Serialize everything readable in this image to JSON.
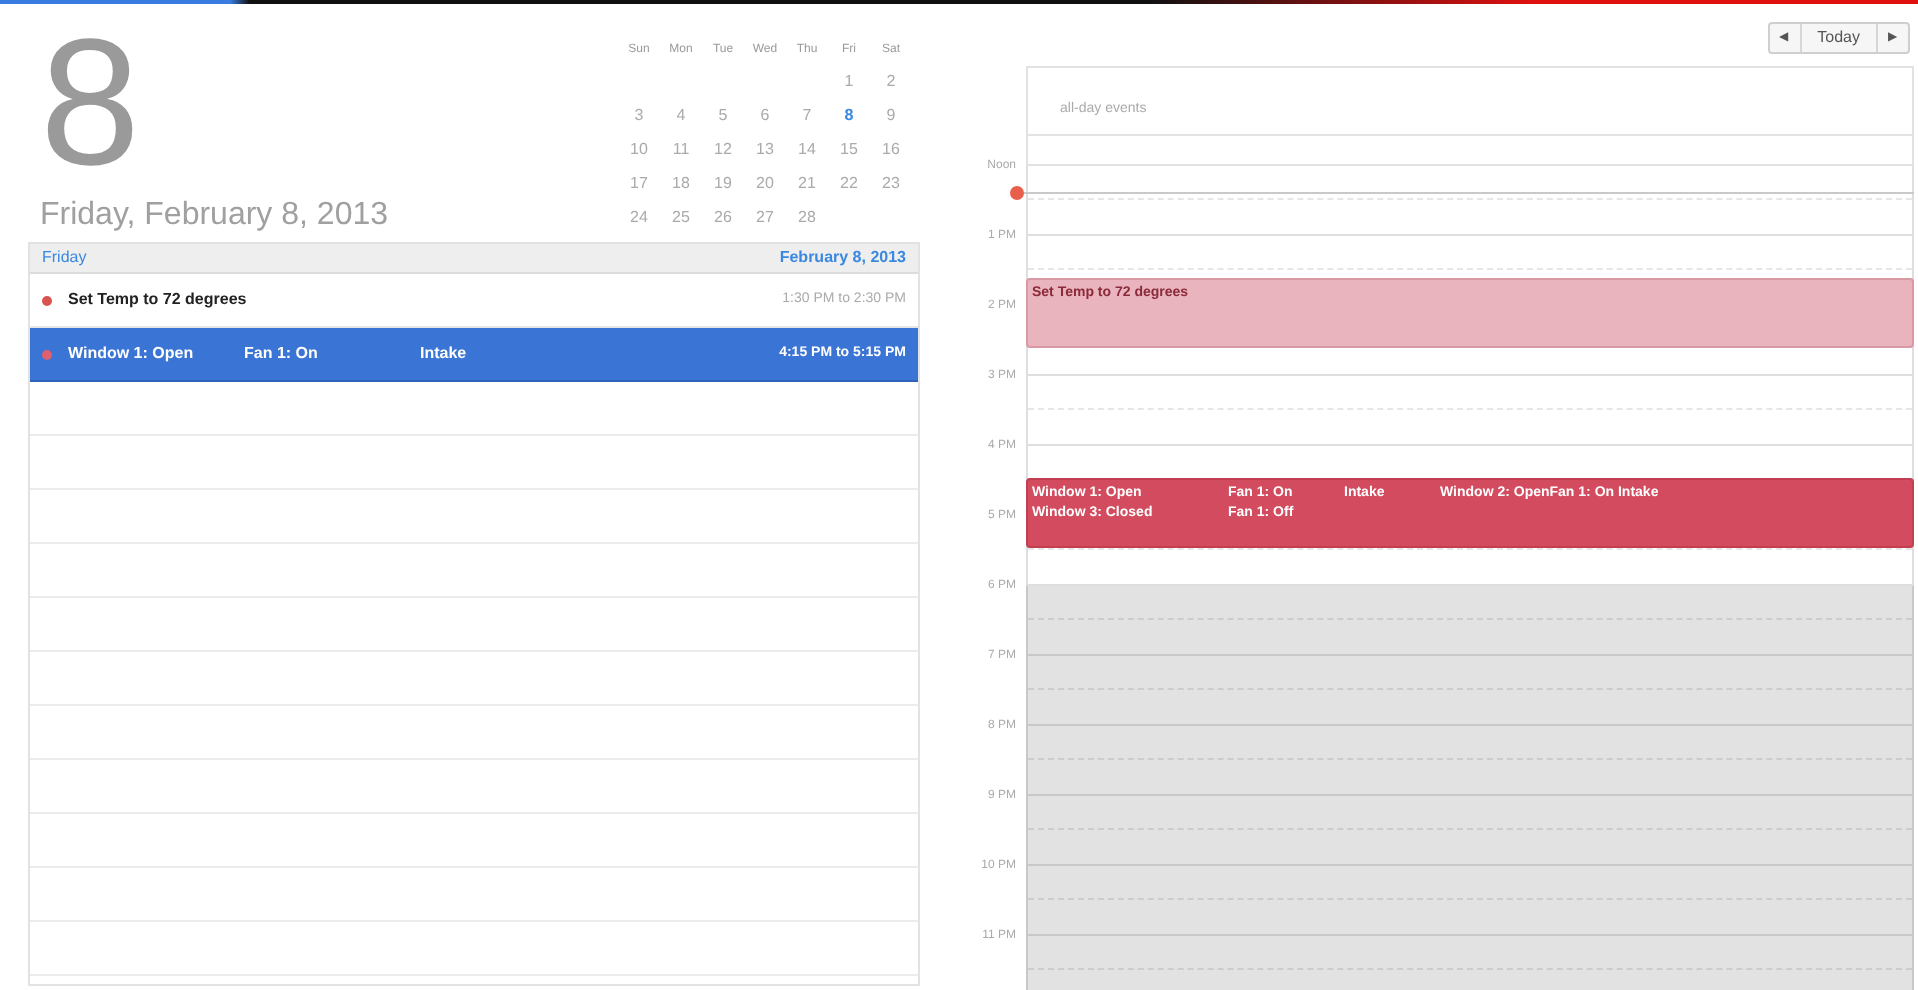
{
  "day_number": "8",
  "date_title": "Friday, February 8, 2013",
  "mini_calendar": {
    "weekdays": [
      "Sun",
      "Mon",
      "Tue",
      "Wed",
      "Thu",
      "Fri",
      "Sat"
    ],
    "weeks": [
      [
        {
          "day": "1",
          "selected": false
        },
        {
          "day": "2",
          "selected": false
        }
      ],
      [
        {
          "day": "3",
          "selected": false
        },
        {
          "day": "4",
          "selected": false
        },
        {
          "day": "5",
          "selected": false
        },
        {
          "day": "6",
          "selected": false
        },
        {
          "day": "7",
          "selected": false
        },
        {
          "day": "8",
          "selected": true
        },
        {
          "day": "9",
          "selected": false
        }
      ],
      [
        {
          "day": "10",
          "selected": false
        },
        {
          "day": "11",
          "selected": false
        },
        {
          "day": "12",
          "selected": false
        },
        {
          "day": "13",
          "selected": false
        },
        {
          "day": "14",
          "selected": false
        },
        {
          "day": "15",
          "selected": false
        },
        {
          "day": "16",
          "selected": false
        }
      ],
      [
        {
          "day": "17",
          "selected": false
        },
        {
          "day": "18",
          "selected": false
        },
        {
          "day": "19",
          "selected": false
        },
        {
          "day": "20",
          "selected": false
        },
        {
          "day": "21",
          "selected": false
        },
        {
          "day": "22",
          "selected": false
        },
        {
          "day": "23",
          "selected": false
        }
      ],
      [
        {
          "day": "24",
          "selected": false
        },
        {
          "day": "25",
          "selected": false
        },
        {
          "day": "26",
          "selected": false
        },
        {
          "day": "27",
          "selected": false
        },
        {
          "day": "28",
          "selected": false
        }
      ]
    ]
  },
  "event_list": {
    "header_day": "Friday",
    "header_date": "February 8, 2013",
    "events": [
      {
        "title_parts": [
          "Set Temp to 72 degrees"
        ],
        "time": "1:30 PM to 2:30 PM",
        "color": "#d9534f",
        "selected": false
      },
      {
        "title_parts": [
          "Window 1: Open",
          "Fan 1: On",
          "Intake"
        ],
        "time": "4:15 PM to 5:15 PM",
        "color": "#e06070",
        "selected": true
      }
    ]
  },
  "nav": {
    "prev": "◀",
    "today": "Today",
    "next": "▶"
  },
  "day_view": {
    "all_day_label": "all-day events",
    "hours": [
      {
        "label": "Noon",
        "shaded": false
      },
      {
        "label": "1 PM",
        "shaded": false
      },
      {
        "label": "2 PM",
        "shaded": false
      },
      {
        "label": "3 PM",
        "shaded": false
      },
      {
        "label": "4 PM",
        "shaded": false
      },
      {
        "label": "5 PM",
        "shaded": false
      },
      {
        "label": "6 PM",
        "shaded": true
      },
      {
        "label": "7 PM",
        "shaded": true
      },
      {
        "label": "8 PM",
        "shaded": true
      },
      {
        "label": "9 PM",
        "shaded": true
      },
      {
        "label": "10 PM",
        "shaded": true
      },
      {
        "label": "11 PM",
        "shaded": true
      }
    ],
    "events": [
      {
        "kind": "light",
        "columns": [
          [
            "Set Temp to 72 degrees"
          ]
        ]
      },
      {
        "kind": "strong",
        "columns": [
          [
            "Window 1: Open",
            "Window 3: Closed"
          ],
          [
            "Fan 1: On",
            "Fan 1: Off"
          ],
          [
            "Intake"
          ],
          [
            "Window 2: OpenFan 1: On Intake"
          ]
        ]
      }
    ]
  }
}
